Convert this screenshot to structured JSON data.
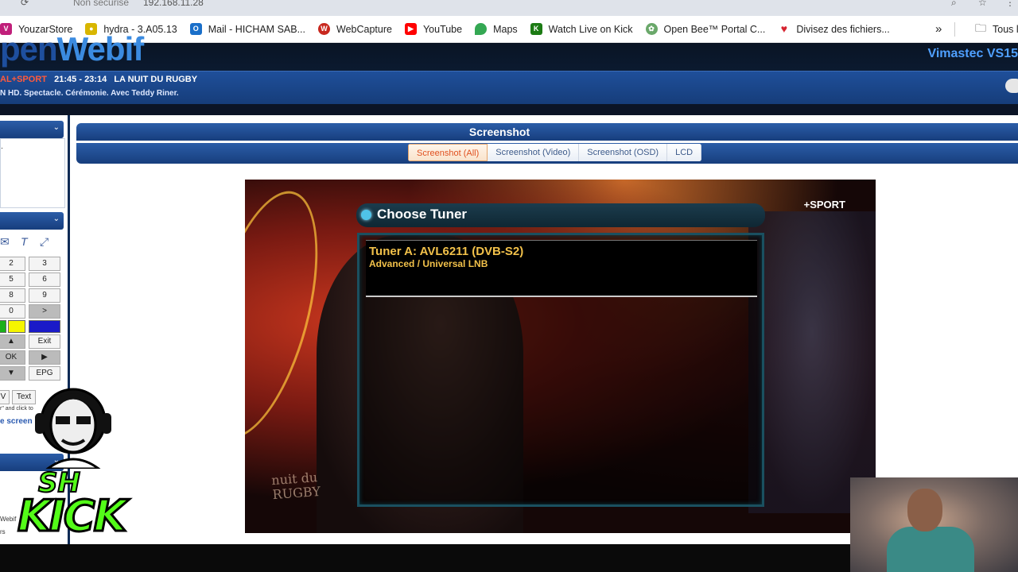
{
  "browser": {
    "url_status": "Non sécurisé",
    "url": "192.168.11.28",
    "bookmarks": [
      {
        "label": "YouzarStore",
        "icon": "youzarstore-icon",
        "color": "#c01f7a"
      },
      {
        "label": "hydra - 3.A05.13",
        "icon": "hydra-icon",
        "color": "#d8b600"
      },
      {
        "label": "Mail - HICHAM SAB...",
        "icon": "outlook-icon",
        "color": "#1a6fc9"
      },
      {
        "label": "WebCapture",
        "icon": "webcapture-icon",
        "color": "#c8281e"
      },
      {
        "label": "YouTube",
        "icon": "youtube-icon",
        "color": "#ff0000"
      },
      {
        "label": "Maps",
        "icon": "maps-icon",
        "color": "#34a853"
      },
      {
        "label": "Watch Live on Kick",
        "icon": "kick-icon",
        "color": "#1c7b14"
      },
      {
        "label": "Open Bee™ Portal C...",
        "icon": "openbee-icon",
        "color": "#6aa86a"
      },
      {
        "label": "Divisez des fichiers...",
        "icon": "heart-icon",
        "color": "#d6232f"
      }
    ],
    "more": "»",
    "all_bookmarks": "Tous l"
  },
  "header": {
    "logo_part1": "pen",
    "logo_part2": "Webif",
    "box_name": "Vimastec VS15"
  },
  "now_playing": {
    "channel": "AL+SPORT",
    "time": "21:45 - 23:14",
    "title": "LA NUIT DU RUGBY",
    "description": "N HD. Spectacle. Cérémonie. Avec Teddy Riner."
  },
  "remote": {
    "keys": [
      "2",
      "3",
      "5",
      "6",
      "8",
      "9",
      "0",
      ">",
      "▲",
      "Exit",
      "OK",
      "▶",
      "▼",
      "EPG"
    ],
    "bottom_keys": [
      "V",
      "Text"
    ],
    "hint": "r\" and click to",
    "screen_link": "e screen"
  },
  "page": {
    "title": "Screenshot",
    "tabs": [
      "Screenshot (All)",
      "Screenshot (Video)",
      "Screenshot (OSD)",
      "LCD"
    ],
    "active_tab": "Screenshot (All)"
  },
  "screenshot": {
    "osd_title": "Choose Tuner",
    "tuner_line1": "Tuner A: AVL6211 (DVB-S2)",
    "tuner_line2": "Advanced / Universal LNB",
    "channel_logo": "+SPORT",
    "show_title_1": "nuit du",
    "show_title_2": "RUGBY"
  },
  "overlay": {
    "streamer_tag": "SH",
    "platform": "KICK"
  },
  "leftpanel": {
    "side_texts": [
      "Webif",
      "rs"
    ]
  }
}
